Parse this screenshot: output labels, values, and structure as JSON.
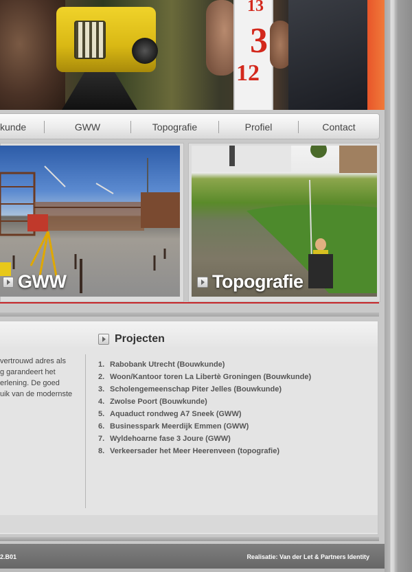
{
  "nav": {
    "items": [
      "kunde",
      "GWW",
      "Topografie",
      "Profiel",
      "Contact"
    ]
  },
  "hero": {
    "staff_numbers": [
      "13",
      "3",
      "12"
    ]
  },
  "panels": [
    {
      "label": "GWW"
    },
    {
      "label": "Topografie"
    }
  ],
  "intro": {
    "lines": [
      "vertrouwd adres als",
      "g garandeert het",
      "erlening. De goed",
      "uik van de modernste"
    ]
  },
  "projects": {
    "title": "Projecten",
    "items": [
      {
        "num": "1.",
        "text": "Rabobank Utrecht (Bouwkunde)"
      },
      {
        "num": "2.",
        "text": "Woon/Kantoor toren La Libertè Groningen (Bouwkunde)"
      },
      {
        "num": "3.",
        "text": "Scholengemeenschap Piter Jelles (Bouwkunde)"
      },
      {
        "num": "4.",
        "text": "Zwolse Poort (Bouwkunde)"
      },
      {
        "num": "5.",
        "text": "Aquaduct rondweg A7 Sneek (GWW)"
      },
      {
        "num": "6.",
        "text": "Businesspark Meerdijk Emmen (GWW)"
      },
      {
        "num": "7.",
        "text": "Wyldehoarne fase 3 Joure (GWW)"
      },
      {
        "num": "8.",
        "text": "Verkeersader het Meer Heerenveen (topografie)"
      }
    ]
  },
  "footer": {
    "code": "2.B01",
    "credit": "Realisatie: Van der Let & Partners Identity"
  },
  "colors": {
    "accent_red": "#c7262a",
    "nav_text": "#444444",
    "footer_bg": "#6e6e6e"
  }
}
